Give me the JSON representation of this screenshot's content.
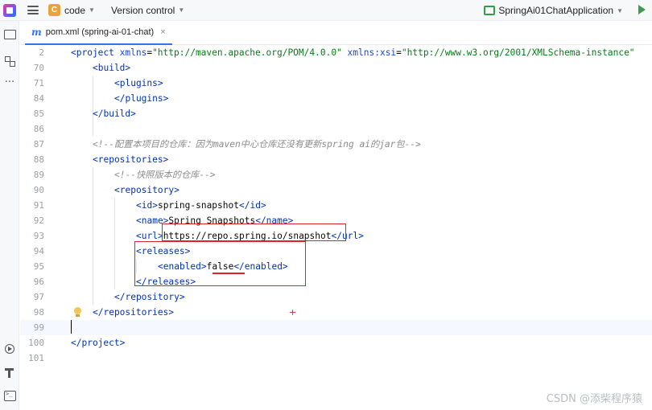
{
  "titlebar": {
    "project_badge": "C",
    "project_name": "code",
    "vcs_label": "Version control",
    "run_config": "SpringAi01ChatApplication"
  },
  "tab": {
    "icon_letter": "m",
    "label": "pom.xml (spring-ai-01-chat)",
    "close": "×"
  },
  "editor": {
    "line_numbers": [
      "2",
      "70",
      "71",
      "84",
      "85",
      "86",
      "87",
      "88",
      "89",
      "90",
      "91",
      "92",
      "93",
      "94",
      "95",
      "96",
      "97",
      "98",
      "99",
      "100",
      "101"
    ],
    "lines": {
      "l2": {
        "open": "<project",
        "a1": " xmlns",
        "eq1": "=",
        "v1": "\"http://maven.apache.org/POM/4.0.0\"",
        "a2": " xmlns:xsi",
        "eq2": "=",
        "v2": "\"http://www.w3.org/2001/XMLSchema-instance\""
      },
      "l70": "<build>",
      "l71": "<plugins>",
      "l84": "</plugins>",
      "l85": "</build>",
      "l87": "<!--配置本项目的仓库：因为maven中心仓库还没有更新spring ai的jar包-->",
      "l88": "<repositories>",
      "l89": "<!--快照版本的仓库-->",
      "l90": "<repository>",
      "l91": {
        "open": "<id>",
        "text": "spring-snapshot",
        "close": "</id>"
      },
      "l92": {
        "open": "<name>",
        "text": "Spring Snapshots",
        "close": "</name>"
      },
      "l93": {
        "open": "<url>",
        "text": "https://repo.spring.io/snapshot",
        "close": "</url>"
      },
      "l94": "<releases>",
      "l95": {
        "open": "<enabled>",
        "text": "false",
        "close": "</enabled>"
      },
      "l96": "</releases>",
      "l97": "</repository>",
      "l98": "</repositories>",
      "l100": "</project>"
    }
  },
  "annotations": {
    "plus": "+"
  },
  "watermark": "CSDN @添柴程序猿"
}
